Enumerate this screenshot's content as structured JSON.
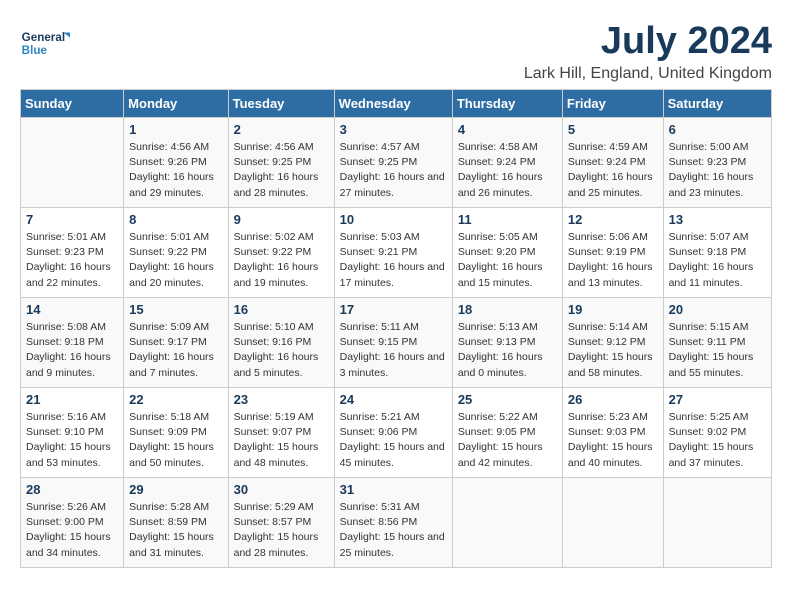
{
  "logo": {
    "line1": "General",
    "line2": "Blue"
  },
  "title": "July 2024",
  "subtitle": "Lark Hill, England, United Kingdom",
  "days_of_week": [
    "Sunday",
    "Monday",
    "Tuesday",
    "Wednesday",
    "Thursday",
    "Friday",
    "Saturday"
  ],
  "weeks": [
    [
      {
        "day": "",
        "sunrise": "",
        "sunset": "",
        "daylight": ""
      },
      {
        "day": "1",
        "sunrise": "Sunrise: 4:56 AM",
        "sunset": "Sunset: 9:26 PM",
        "daylight": "Daylight: 16 hours and 29 minutes."
      },
      {
        "day": "2",
        "sunrise": "Sunrise: 4:56 AM",
        "sunset": "Sunset: 9:25 PM",
        "daylight": "Daylight: 16 hours and 28 minutes."
      },
      {
        "day": "3",
        "sunrise": "Sunrise: 4:57 AM",
        "sunset": "Sunset: 9:25 PM",
        "daylight": "Daylight: 16 hours and 27 minutes."
      },
      {
        "day": "4",
        "sunrise": "Sunrise: 4:58 AM",
        "sunset": "Sunset: 9:24 PM",
        "daylight": "Daylight: 16 hours and 26 minutes."
      },
      {
        "day": "5",
        "sunrise": "Sunrise: 4:59 AM",
        "sunset": "Sunset: 9:24 PM",
        "daylight": "Daylight: 16 hours and 25 minutes."
      },
      {
        "day": "6",
        "sunrise": "Sunrise: 5:00 AM",
        "sunset": "Sunset: 9:23 PM",
        "daylight": "Daylight: 16 hours and 23 minutes."
      }
    ],
    [
      {
        "day": "7",
        "sunrise": "Sunrise: 5:01 AM",
        "sunset": "Sunset: 9:23 PM",
        "daylight": "Daylight: 16 hours and 22 minutes."
      },
      {
        "day": "8",
        "sunrise": "Sunrise: 5:01 AM",
        "sunset": "Sunset: 9:22 PM",
        "daylight": "Daylight: 16 hours and 20 minutes."
      },
      {
        "day": "9",
        "sunrise": "Sunrise: 5:02 AM",
        "sunset": "Sunset: 9:22 PM",
        "daylight": "Daylight: 16 hours and 19 minutes."
      },
      {
        "day": "10",
        "sunrise": "Sunrise: 5:03 AM",
        "sunset": "Sunset: 9:21 PM",
        "daylight": "Daylight: 16 hours and 17 minutes."
      },
      {
        "day": "11",
        "sunrise": "Sunrise: 5:05 AM",
        "sunset": "Sunset: 9:20 PM",
        "daylight": "Daylight: 16 hours and 15 minutes."
      },
      {
        "day": "12",
        "sunrise": "Sunrise: 5:06 AM",
        "sunset": "Sunset: 9:19 PM",
        "daylight": "Daylight: 16 hours and 13 minutes."
      },
      {
        "day": "13",
        "sunrise": "Sunrise: 5:07 AM",
        "sunset": "Sunset: 9:18 PM",
        "daylight": "Daylight: 16 hours and 11 minutes."
      }
    ],
    [
      {
        "day": "14",
        "sunrise": "Sunrise: 5:08 AM",
        "sunset": "Sunset: 9:18 PM",
        "daylight": "Daylight: 16 hours and 9 minutes."
      },
      {
        "day": "15",
        "sunrise": "Sunrise: 5:09 AM",
        "sunset": "Sunset: 9:17 PM",
        "daylight": "Daylight: 16 hours and 7 minutes."
      },
      {
        "day": "16",
        "sunrise": "Sunrise: 5:10 AM",
        "sunset": "Sunset: 9:16 PM",
        "daylight": "Daylight: 16 hours and 5 minutes."
      },
      {
        "day": "17",
        "sunrise": "Sunrise: 5:11 AM",
        "sunset": "Sunset: 9:15 PM",
        "daylight": "Daylight: 16 hours and 3 minutes."
      },
      {
        "day": "18",
        "sunrise": "Sunrise: 5:13 AM",
        "sunset": "Sunset: 9:13 PM",
        "daylight": "Daylight: 16 hours and 0 minutes."
      },
      {
        "day": "19",
        "sunrise": "Sunrise: 5:14 AM",
        "sunset": "Sunset: 9:12 PM",
        "daylight": "Daylight: 15 hours and 58 minutes."
      },
      {
        "day": "20",
        "sunrise": "Sunrise: 5:15 AM",
        "sunset": "Sunset: 9:11 PM",
        "daylight": "Daylight: 15 hours and 55 minutes."
      }
    ],
    [
      {
        "day": "21",
        "sunrise": "Sunrise: 5:16 AM",
        "sunset": "Sunset: 9:10 PM",
        "daylight": "Daylight: 15 hours and 53 minutes."
      },
      {
        "day": "22",
        "sunrise": "Sunrise: 5:18 AM",
        "sunset": "Sunset: 9:09 PM",
        "daylight": "Daylight: 15 hours and 50 minutes."
      },
      {
        "day": "23",
        "sunrise": "Sunrise: 5:19 AM",
        "sunset": "Sunset: 9:07 PM",
        "daylight": "Daylight: 15 hours and 48 minutes."
      },
      {
        "day": "24",
        "sunrise": "Sunrise: 5:21 AM",
        "sunset": "Sunset: 9:06 PM",
        "daylight": "Daylight: 15 hours and 45 minutes."
      },
      {
        "day": "25",
        "sunrise": "Sunrise: 5:22 AM",
        "sunset": "Sunset: 9:05 PM",
        "daylight": "Daylight: 15 hours and 42 minutes."
      },
      {
        "day": "26",
        "sunrise": "Sunrise: 5:23 AM",
        "sunset": "Sunset: 9:03 PM",
        "daylight": "Daylight: 15 hours and 40 minutes."
      },
      {
        "day": "27",
        "sunrise": "Sunrise: 5:25 AM",
        "sunset": "Sunset: 9:02 PM",
        "daylight": "Daylight: 15 hours and 37 minutes."
      }
    ],
    [
      {
        "day": "28",
        "sunrise": "Sunrise: 5:26 AM",
        "sunset": "Sunset: 9:00 PM",
        "daylight": "Daylight: 15 hours and 34 minutes."
      },
      {
        "day": "29",
        "sunrise": "Sunrise: 5:28 AM",
        "sunset": "Sunset: 8:59 PM",
        "daylight": "Daylight: 15 hours and 31 minutes."
      },
      {
        "day": "30",
        "sunrise": "Sunrise: 5:29 AM",
        "sunset": "Sunset: 8:57 PM",
        "daylight": "Daylight: 15 hours and 28 minutes."
      },
      {
        "day": "31",
        "sunrise": "Sunrise: 5:31 AM",
        "sunset": "Sunset: 8:56 PM",
        "daylight": "Daylight: 15 hours and 25 minutes."
      },
      {
        "day": "",
        "sunrise": "",
        "sunset": "",
        "daylight": ""
      },
      {
        "day": "",
        "sunrise": "",
        "sunset": "",
        "daylight": ""
      },
      {
        "day": "",
        "sunrise": "",
        "sunset": "",
        "daylight": ""
      }
    ]
  ]
}
